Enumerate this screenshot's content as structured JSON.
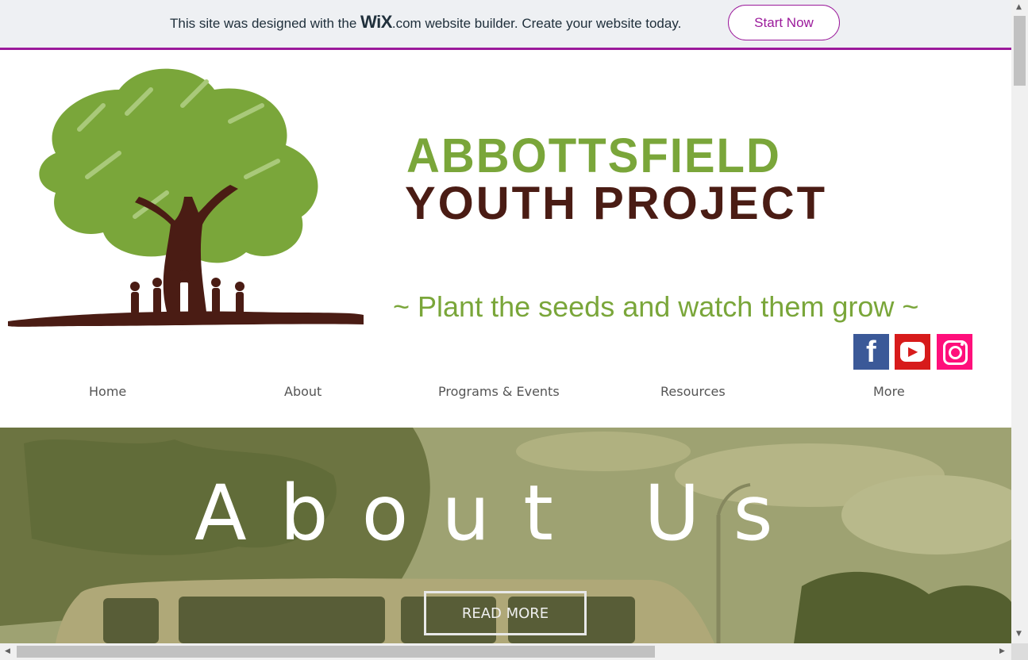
{
  "wix_banner": {
    "text_before": "This site was designed with the ",
    "logo_text": "WiX",
    "logo_suffix": ".com",
    "text_after": " website builder. Create your website today.",
    "button_label": "Start Now"
  },
  "brand": {
    "line1": "ABBOTTSFIELD",
    "line2": "YOUTH PROJECT",
    "tagline": "~ Plant the seeds and watch them grow ~"
  },
  "social": {
    "facebook_glyph": "f",
    "youtube_glyph": "▶",
    "instagram_glyph": "◎"
  },
  "nav": {
    "items": [
      "Home",
      "About",
      "Programs & Events",
      "Resources",
      "More"
    ]
  },
  "hero": {
    "title": "About Us",
    "button_label": "READ MORE"
  },
  "colors": {
    "accent": "#9b1a9b",
    "brand_green": "#7aa63a",
    "brand_brown": "#4a1c14"
  }
}
